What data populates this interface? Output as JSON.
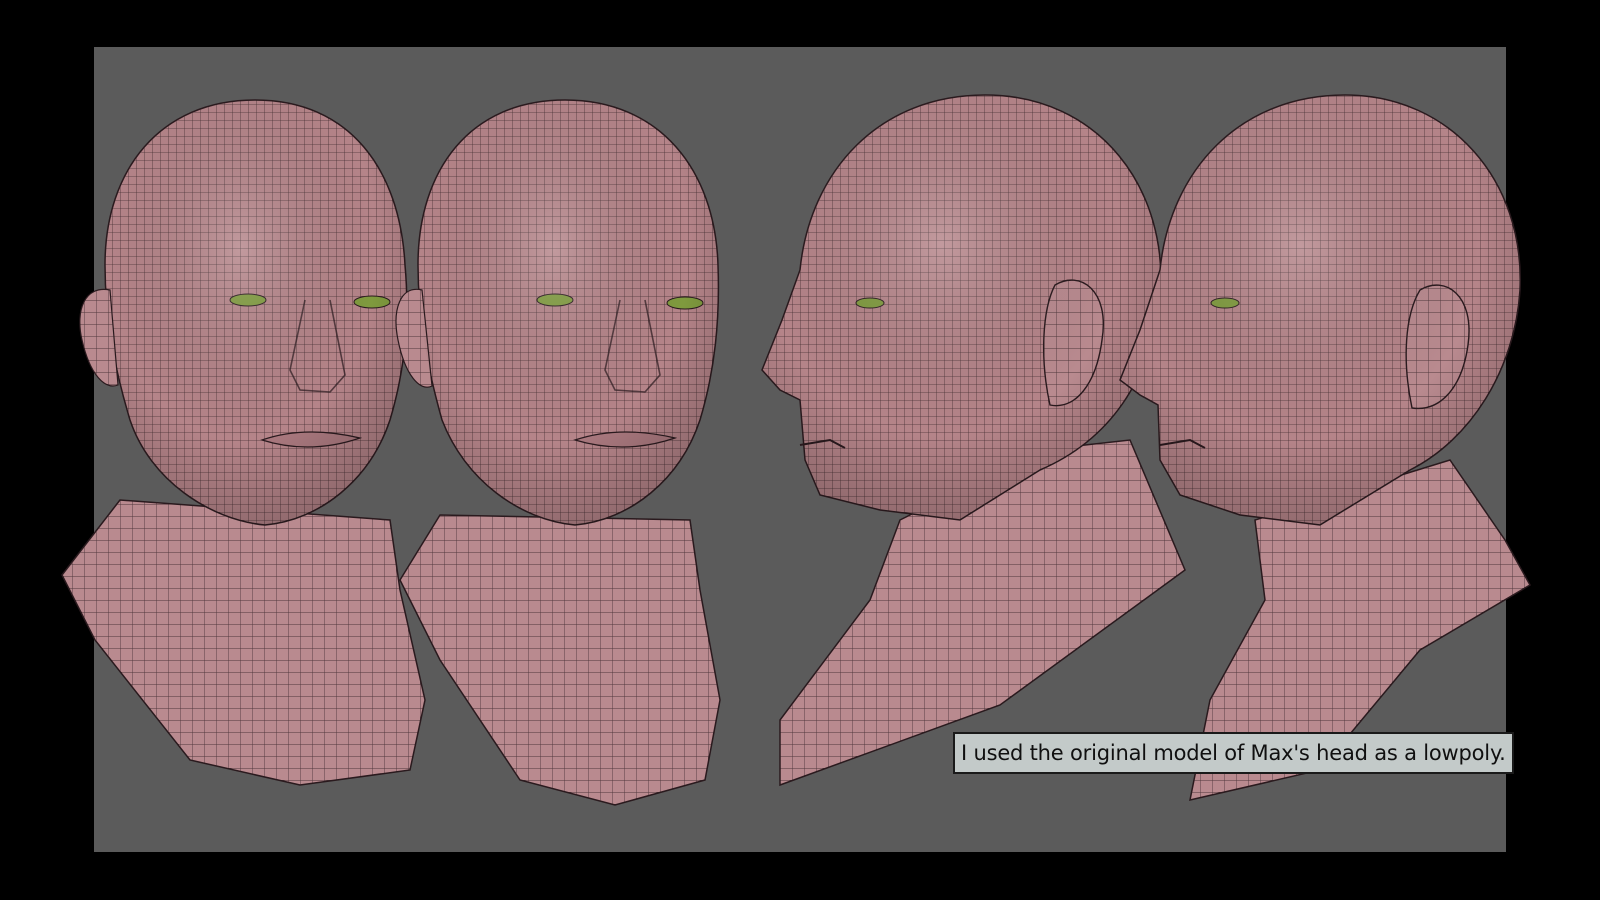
{
  "scene": {
    "background_color": "#000000",
    "viewport_color": "#5b5b5b",
    "skin_color": "#b98a8f",
    "wire_color": "#2a1a1e",
    "eye_color": "#7f9a3e",
    "views": [
      {
        "name": "front-three-quarter-left"
      },
      {
        "name": "front-three-quarter-right"
      },
      {
        "name": "profile-left"
      },
      {
        "name": "profile-left-tilted"
      }
    ]
  },
  "caption": {
    "text": "I used the original model of Max's head as a lowpoly."
  }
}
